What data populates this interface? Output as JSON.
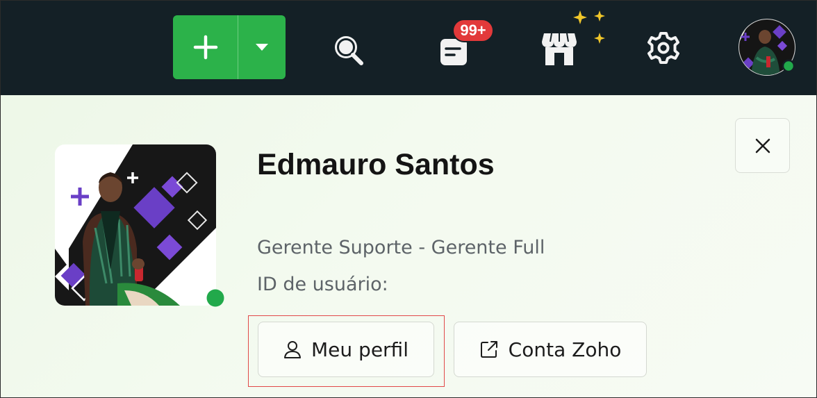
{
  "topbar": {
    "create_button": {
      "plus_icon": "plus-icon",
      "dropdown_icon": "caret-down-icon"
    },
    "search_icon": "search-icon",
    "feed": {
      "icon": "feed-icon",
      "badge": "99+"
    },
    "marketplace_icon": "store-icon",
    "settings_icon": "gear-icon",
    "user_avatar": {
      "status": "online"
    }
  },
  "profile": {
    "name": "Edmauro Santos",
    "role": "Gerente Suporte - Gerente Full",
    "user_id_label": "ID de usuário:",
    "status": "online",
    "buttons": {
      "my_profile": "Meu perfil",
      "zoho_account": "Conta Zoho"
    }
  },
  "colors": {
    "topbar_bg": "#142026",
    "primary_green": "#2cb24a",
    "badge_red": "#e2393a",
    "online_green": "#22a94b",
    "highlight_red": "#e14848"
  }
}
